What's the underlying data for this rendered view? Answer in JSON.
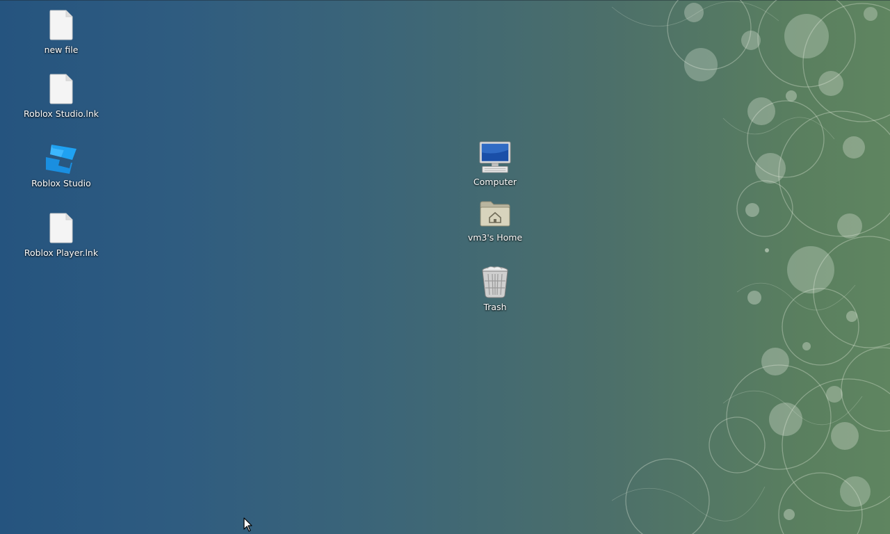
{
  "desktop": {
    "left_icons": [
      {
        "label": "new file",
        "icon": "blank-file-icon"
      },
      {
        "label": "Roblox Studio.lnk",
        "icon": "blank-file-icon"
      },
      {
        "label": "Roblox Studio",
        "icon": "roblox-studio-icon"
      },
      {
        "label": "Roblox Player.lnk",
        "icon": "blank-file-icon"
      }
    ],
    "center_icons": [
      {
        "label": "Computer",
        "icon": "computer-icon"
      },
      {
        "label": "vm3's Home",
        "icon": "home-folder-icon"
      },
      {
        "label": "Trash",
        "icon": "trash-icon"
      }
    ]
  },
  "colors": {
    "background_left": "#25547f",
    "background_right": "#5f8560",
    "label_text": "#ffffff",
    "roblox_blue": "#1fa2f2"
  }
}
